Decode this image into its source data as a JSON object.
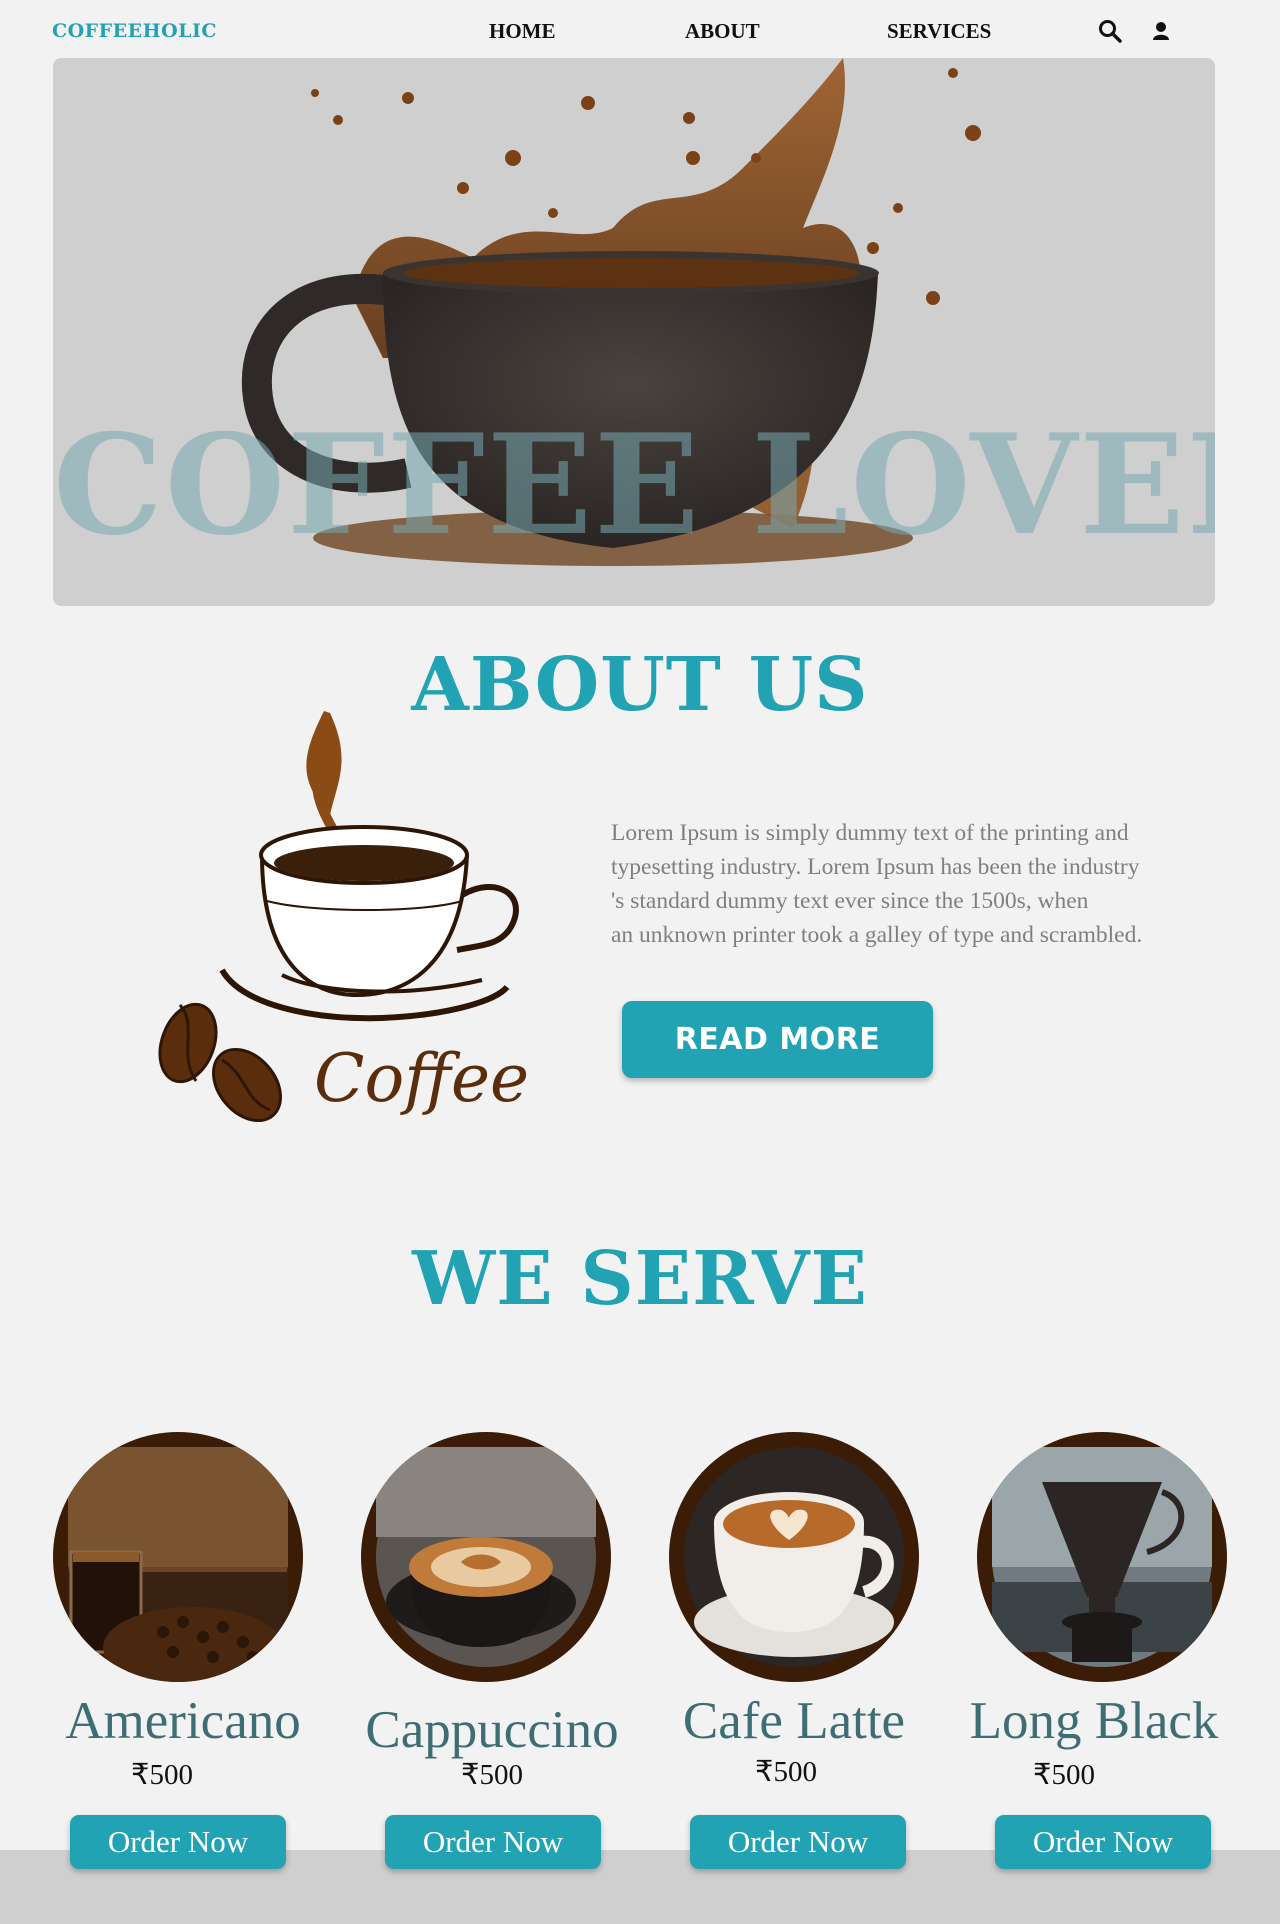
{
  "nav": {
    "brand": "COFFEEHOLIC",
    "links": [
      "HOME",
      "ABOUT",
      "SERVICES"
    ],
    "icons": [
      "search-icon",
      "user-icon"
    ]
  },
  "hero": {
    "title": "COFFEE LOVER"
  },
  "about": {
    "heading": "ABOUT US",
    "logo_text": "Coffee",
    "paragraph_lines": [
      "Lorem Ipsum is simply dummy text of the printing and",
      "typesetting industry. Lorem Ipsum has been the industry",
      "'s standard dummy text ever since the 1500s, when",
      "an unknown printer took a galley of type and scrambled."
    ],
    "button_label": "READ MORE"
  },
  "serve": {
    "heading": "WE SERVE",
    "products": [
      {
        "name": "Americano",
        "price": "₹500",
        "button": "Order Now"
      },
      {
        "name": "Cappuccino",
        "price": "₹500",
        "button": "Order Now"
      },
      {
        "name": "Cafe Latte",
        "price": "₹500",
        "button": "Order Now"
      },
      {
        "name": "Long Black",
        "price": "₹500",
        "button": "Order Now"
      }
    ]
  },
  "colors": {
    "accent": "#22a3b3",
    "product_ring": "#3a1c07",
    "product_name": "#3e6d73",
    "body_text": "#7f7f7f",
    "background": "#f2f2f2"
  }
}
